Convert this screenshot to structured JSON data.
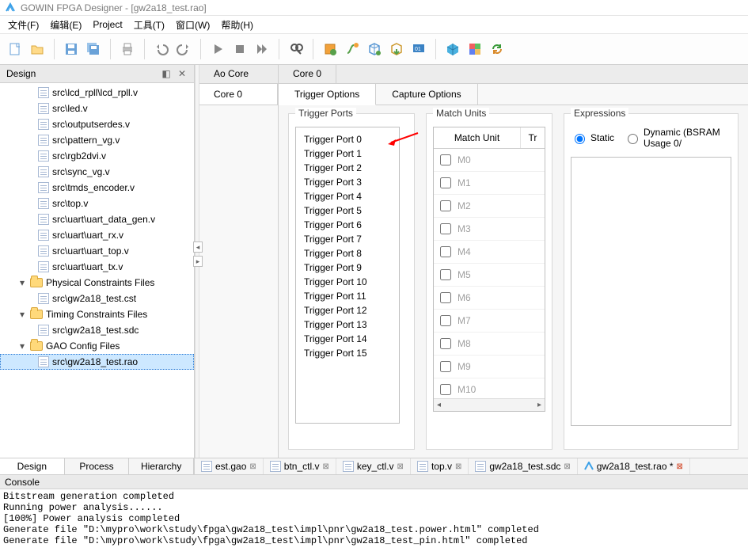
{
  "title": "GOWIN FPGA Designer - [gw2a18_test.rao]",
  "menu": [
    "文件(F)",
    "编辑(E)",
    "Project",
    "工具(T)",
    "窗口(W)",
    "帮助(H)"
  ],
  "design_panel": {
    "title": "Design",
    "files": [
      "src\\lcd_rpll\\lcd_rpll.v",
      "src\\led.v",
      "src\\outputserdes.v",
      "src\\pattern_vg.v",
      "src\\rgb2dvi.v",
      "src\\sync_vg.v",
      "src\\tmds_encoder.v",
      "src\\top.v",
      "src\\uart\\uart_data_gen.v",
      "src\\uart\\uart_rx.v",
      "src\\uart\\uart_top.v",
      "src\\uart\\uart_tx.v"
    ],
    "folders": [
      {
        "label": "Physical Constraints Files",
        "children": [
          "src\\gw2a18_test.cst"
        ]
      },
      {
        "label": "Timing Constraints Files",
        "children": [
          "src\\gw2a18_test.sdc"
        ]
      },
      {
        "label": "GAO Config Files",
        "children": [
          "src\\gw2a18_test.rao"
        ],
        "selected_child": 0
      }
    ],
    "bottom_tabs": [
      "Design",
      "Process",
      "Hierarchy"
    ],
    "active_bottom_tab": 0
  },
  "core": {
    "header_left": "Ao Core",
    "header_right": "Core 0",
    "side_tab": "Core 0",
    "option_tabs": [
      "Trigger Options",
      "Capture Options"
    ],
    "active_option_tab": 0,
    "trigger_ports": {
      "legend": "Trigger Ports",
      "items": [
        "Trigger Port 0",
        "Trigger Port 1",
        "Trigger Port 2",
        "Trigger Port 3",
        "Trigger Port 4",
        "Trigger Port 5",
        "Trigger Port 6",
        "Trigger Port 7",
        "Trigger Port 8",
        "Trigger Port 9",
        "Trigger Port 10",
        "Trigger Port 11",
        "Trigger Port 12",
        "Trigger Port 13",
        "Trigger Port 14",
        "Trigger Port 15"
      ]
    },
    "match_units": {
      "legend": "Match Units",
      "col1": "Match Unit",
      "col2": "Tr",
      "rows": [
        "M0",
        "M1",
        "M2",
        "M3",
        "M4",
        "M5",
        "M6",
        "M7",
        "M8",
        "M9",
        "M10"
      ]
    },
    "expressions": {
      "legend": "Expressions",
      "static_label": "Static",
      "dynamic_label": "Dynamic (BSRAM Usage 0/",
      "selected": "static"
    }
  },
  "doc_tabs": [
    {
      "label": "est.gao",
      "icon": "file-icon"
    },
    {
      "label": "btn_ctl.v",
      "icon": "file-icon"
    },
    {
      "label": "key_ctl.v",
      "icon": "file-icon"
    },
    {
      "label": "top.v",
      "icon": "file-icon"
    },
    {
      "label": "gw2a18_test.sdc",
      "icon": "file-icon"
    },
    {
      "label": "gw2a18_test.rao *",
      "icon": "gowin-icon"
    }
  ],
  "console": {
    "title": "Console",
    "lines": [
      "Bitstream generation completed",
      "Running power analysis......",
      "[100%] Power analysis completed",
      "Generate file \"D:\\mypro\\work\\study\\fpga\\gw2a18_test\\impl\\pnr\\gw2a18_test.power.html\" completed",
      "Generate file \"D:\\mypro\\work\\study\\fpga\\gw2a18_test\\impl\\pnr\\gw2a18_test_pin.html\" completed"
    ]
  }
}
